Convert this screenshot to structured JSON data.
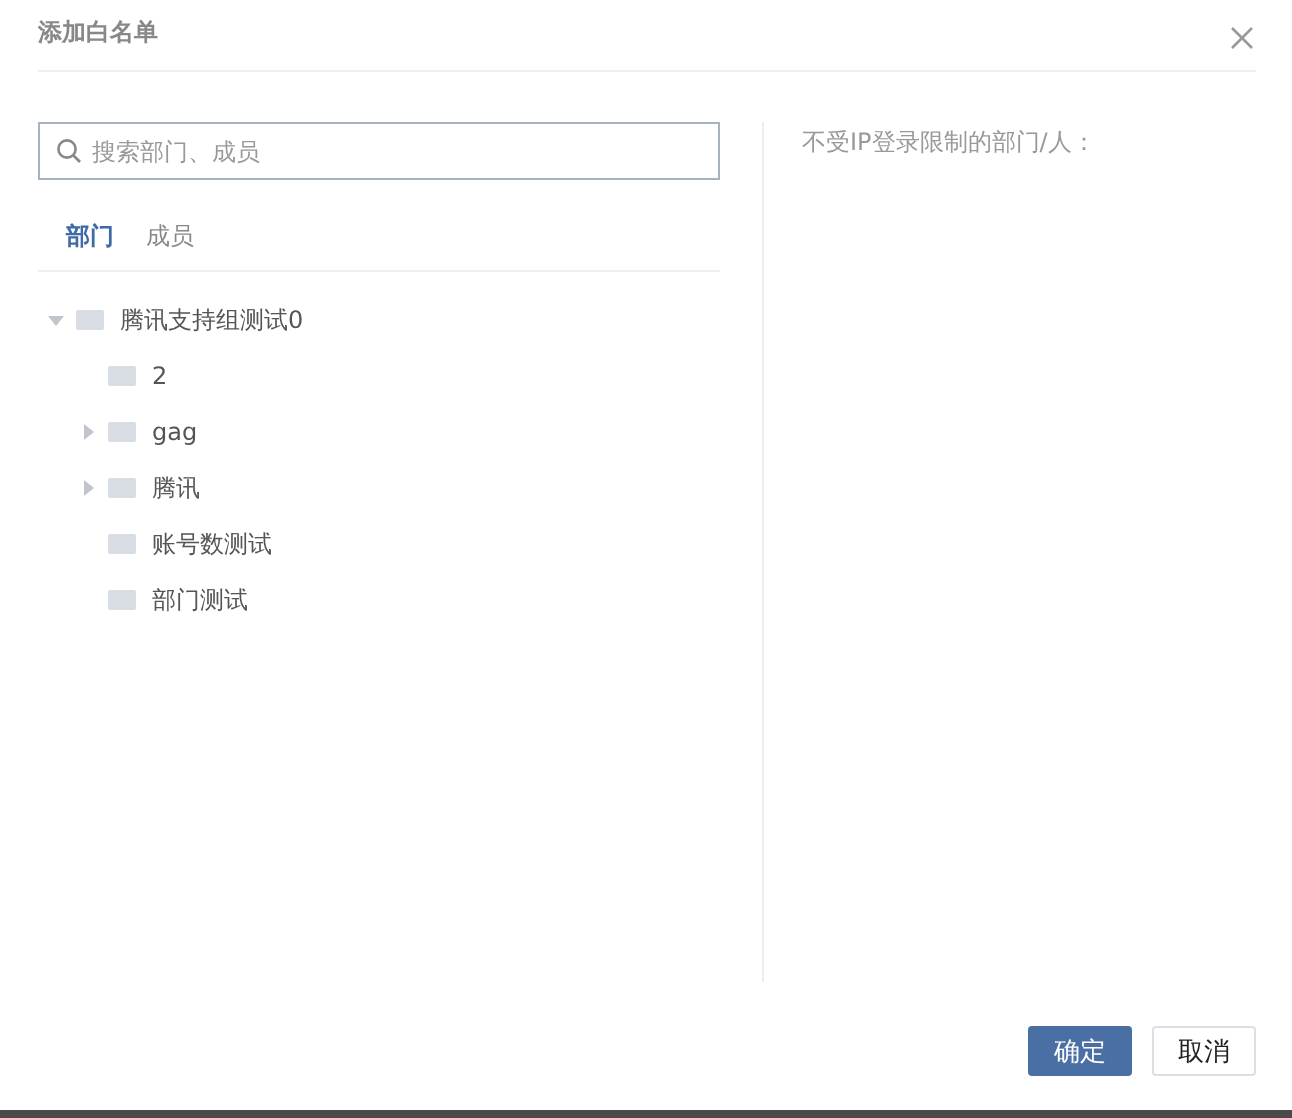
{
  "dialog": {
    "title": "添加白名单"
  },
  "search": {
    "placeholder": "搜索部门、成员"
  },
  "tabs": [
    {
      "label": "部门",
      "selected": true
    },
    {
      "label": "成员",
      "selected": false
    }
  ],
  "tree": [
    {
      "label": "腾讯支持组测试0",
      "kind": "branch",
      "expanded": true,
      "children": [
        {
          "label": "2",
          "kind": "leaf"
        },
        {
          "label": "gag",
          "kind": "branch",
          "expanded": false
        },
        {
          "label": "腾讯",
          "kind": "branch",
          "expanded": false
        },
        {
          "label": "账号数测试",
          "kind": "leaf"
        },
        {
          "label": "部门测试",
          "kind": "leaf"
        }
      ]
    }
  ],
  "selected_panel": {
    "label": "不受IP登录限制的部门/人："
  },
  "buttons": [
    {
      "label": "确定",
      "kind": "primary"
    },
    {
      "label": "取消",
      "kind": "secondary"
    }
  ]
}
